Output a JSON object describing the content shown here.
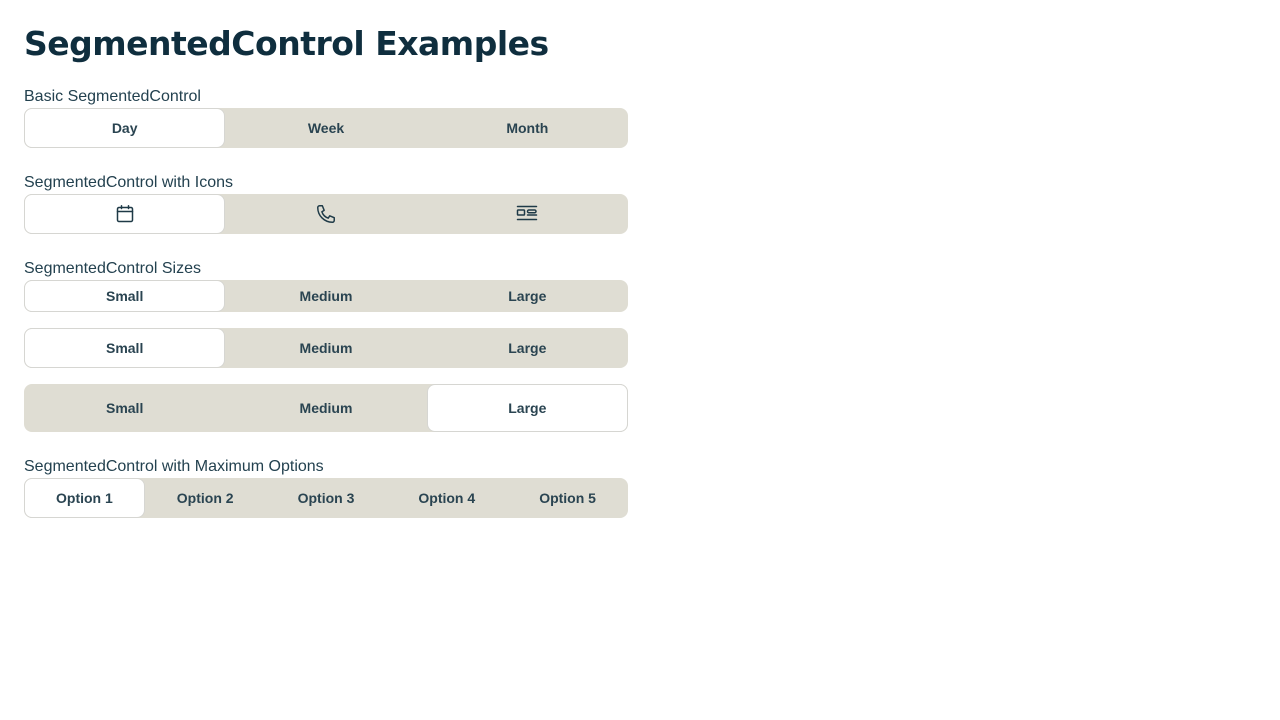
{
  "page_title": "SegmentedControl Examples",
  "basic": {
    "label": "Basic SegmentedControl",
    "options": [
      "Day",
      "Week",
      "Month"
    ],
    "selected_index": 0
  },
  "icons": {
    "label": "SegmentedControl with Icons",
    "options": [
      "calendar-icon",
      "phone-icon",
      "id-card-icon"
    ],
    "selected_index": 0
  },
  "sizes": {
    "label": "SegmentedControl Sizes",
    "small": {
      "options": [
        "Small",
        "Medium",
        "Large"
      ],
      "selected_index": 0
    },
    "medium": {
      "options": [
        "Small",
        "Medium",
        "Large"
      ],
      "selected_index": 0
    },
    "large": {
      "options": [
        "Small",
        "Medium",
        "Large"
      ],
      "selected_index": 2
    }
  },
  "maximum": {
    "label": "SegmentedControl with Maximum Options",
    "options": [
      "Option 1",
      "Option 2",
      "Option 3",
      "Option 4",
      "Option 5"
    ],
    "selected_index": 0
  },
  "colors": {
    "track": "#dfddd3",
    "selected_bg": "#ffffff",
    "text": "#2a4451",
    "title": "#0f2e3e"
  }
}
